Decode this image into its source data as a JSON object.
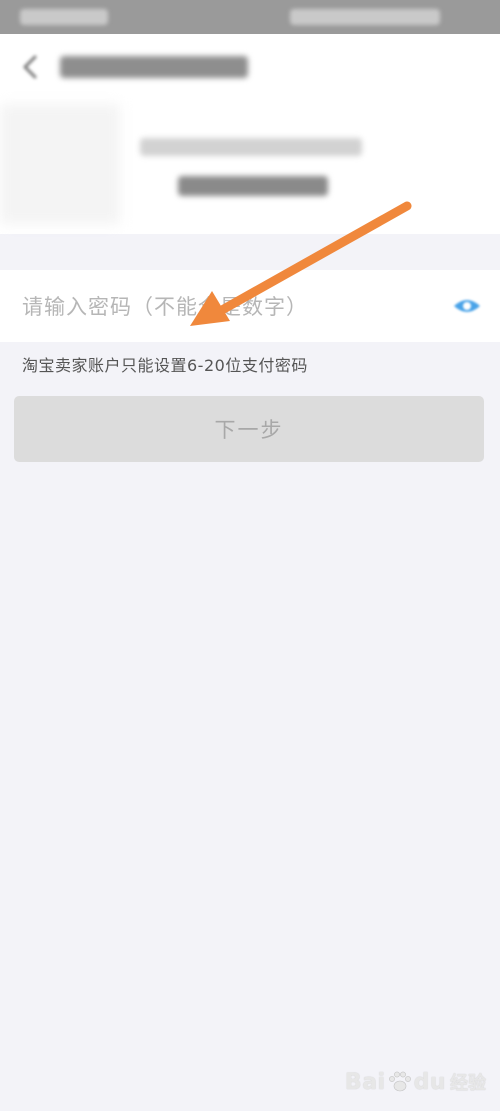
{
  "password_field": {
    "placeholder": "请输入密码（不能全是数字）",
    "value": ""
  },
  "hint": {
    "text": "淘宝卖家账户只能设置6-20位支付密码"
  },
  "next_button": {
    "label": "下一步"
  },
  "watermark": {
    "logo_text": "Bai",
    "logo_suffix": "du",
    "sub_text": "经验"
  },
  "colors": {
    "page_background": "#f3f3f8",
    "arrow": "#f0883c",
    "button_disabled": "#dcdcdc",
    "eye_icon": "#4aa3e8"
  }
}
